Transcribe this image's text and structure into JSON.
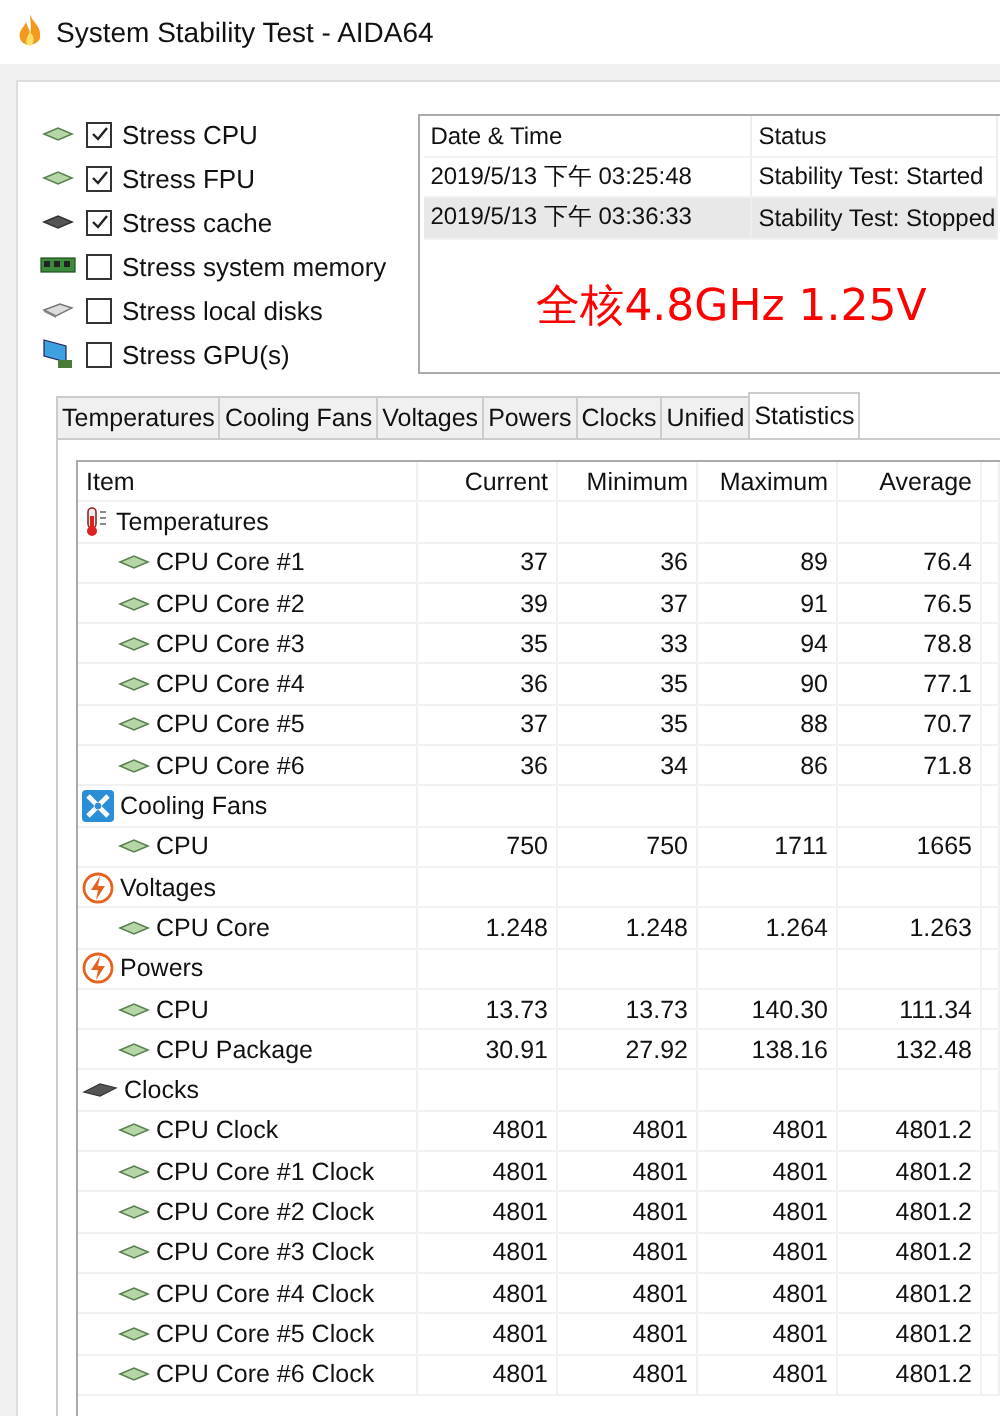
{
  "window": {
    "title": "System Stability Test - AIDA64"
  },
  "stress_options": [
    {
      "label": "Stress CPU",
      "checked": true
    },
    {
      "label": "Stress FPU",
      "checked": true
    },
    {
      "label": "Stress cache",
      "checked": true
    },
    {
      "label": "Stress system memory",
      "checked": false
    },
    {
      "label": "Stress local disks",
      "checked": false
    },
    {
      "label": "Stress GPU(s)",
      "checked": false
    }
  ],
  "log": {
    "columns": [
      "Date & Time",
      "Status"
    ],
    "rows": [
      {
        "cells": [
          "2019/5/13 下午 03:25:48",
          "Stability Test: Started"
        ],
        "selected": false
      },
      {
        "cells": [
          "2019/5/13 下午 03:36:33",
          "Stability Test: Stopped"
        ],
        "selected": true
      }
    ]
  },
  "annotation": "全核4.8GHz 1.25V",
  "tabs": [
    {
      "label": "Temperatures",
      "selected": false
    },
    {
      "label": "Cooling Fans",
      "selected": false
    },
    {
      "label": "Voltages",
      "selected": false
    },
    {
      "label": "Powers",
      "selected": false
    },
    {
      "label": "Clocks",
      "selected": false
    },
    {
      "label": "Unified",
      "selected": false
    },
    {
      "label": "Statistics",
      "selected": true
    }
  ],
  "statistics": {
    "columns": [
      "Item",
      "Current",
      "Minimum",
      "Maximum",
      "Average"
    ],
    "groups": [
      {
        "label": "Temperatures",
        "children": [
          {
            "label": "CPU Core #1",
            "values": [
              "37",
              "36",
              "89",
              "76.4"
            ]
          },
          {
            "label": "CPU Core #2",
            "values": [
              "39",
              "37",
              "91",
              "76.5"
            ]
          },
          {
            "label": "CPU Core #3",
            "values": [
              "35",
              "33",
              "94",
              "78.8"
            ]
          },
          {
            "label": "CPU Core #4",
            "values": [
              "36",
              "35",
              "90",
              "77.1"
            ]
          },
          {
            "label": "CPU Core #5",
            "values": [
              "37",
              "35",
              "88",
              "70.7"
            ]
          },
          {
            "label": "CPU Core #6",
            "values": [
              "36",
              "34",
              "86",
              "71.8"
            ]
          }
        ]
      },
      {
        "label": "Cooling Fans",
        "children": [
          {
            "label": "CPU",
            "values": [
              "750",
              "750",
              "1711",
              "1665"
            ]
          }
        ]
      },
      {
        "label": "Voltages",
        "children": [
          {
            "label": "CPU Core",
            "values": [
              "1.248",
              "1.248",
              "1.264",
              "1.263"
            ]
          }
        ]
      },
      {
        "label": "Powers",
        "children": [
          {
            "label": "CPU",
            "values": [
              "13.73",
              "13.73",
              "140.30",
              "111.34"
            ]
          },
          {
            "label": "CPU Package",
            "values": [
              "30.91",
              "27.92",
              "138.16",
              "132.48"
            ]
          }
        ]
      },
      {
        "label": "Clocks",
        "children": [
          {
            "label": "CPU Clock",
            "values": [
              "4801",
              "4801",
              "4801",
              "4801.2"
            ]
          },
          {
            "label": "CPU Core #1 Clock",
            "values": [
              "4801",
              "4801",
              "4801",
              "4801.2"
            ]
          },
          {
            "label": "CPU Core #2 Clock",
            "values": [
              "4801",
              "4801",
              "4801",
              "4801.2"
            ]
          },
          {
            "label": "CPU Core #3 Clock",
            "values": [
              "4801",
              "4801",
              "4801",
              "4801.2"
            ]
          },
          {
            "label": "CPU Core #4 Clock",
            "values": [
              "4801",
              "4801",
              "4801",
              "4801.2"
            ]
          },
          {
            "label": "CPU Core #5 Clock",
            "values": [
              "4801",
              "4801",
              "4801",
              "4801.2"
            ]
          },
          {
            "label": "CPU Core #6 Clock",
            "values": [
              "4801",
              "4801",
              "4801",
              "4801.2"
            ]
          }
        ]
      }
    ]
  }
}
